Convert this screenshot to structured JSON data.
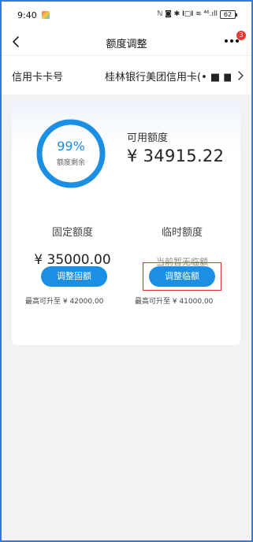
{
  "status_bar": {
    "time": "9:40",
    "icons_text": "ℕ ◙ ✱ 𝐈▢𝐈 ≋ ⁴⁶.ıll",
    "battery": "62"
  },
  "nav": {
    "title": "额度调整",
    "badge_count": "3"
  },
  "card_row": {
    "label": "信用卡卡号",
    "value": "桂林银行美团信用卡(• ■ ■ ■"
  },
  "credit": {
    "percent_remaining": 99,
    "percent_text": "99%",
    "percent_caption": "额度剩余",
    "available_label": "可用额度",
    "available_amount": "¥ 34915.22"
  },
  "fixed": {
    "title": "固定额度",
    "amount": "¥ 35000.00",
    "button_label": "调整固额",
    "max_note": "最高可升至 ¥ 42000.00"
  },
  "temporary": {
    "title": "临时额度",
    "status": "当前暂无临额",
    "button_label": "调整临额",
    "max_note": "最高可升至 ¥ 41000.00"
  },
  "colors": {
    "accent": "#1a8fe3",
    "highlight": "#e03030",
    "badge": "#e53a33",
    "frame": "#3a78d8"
  }
}
